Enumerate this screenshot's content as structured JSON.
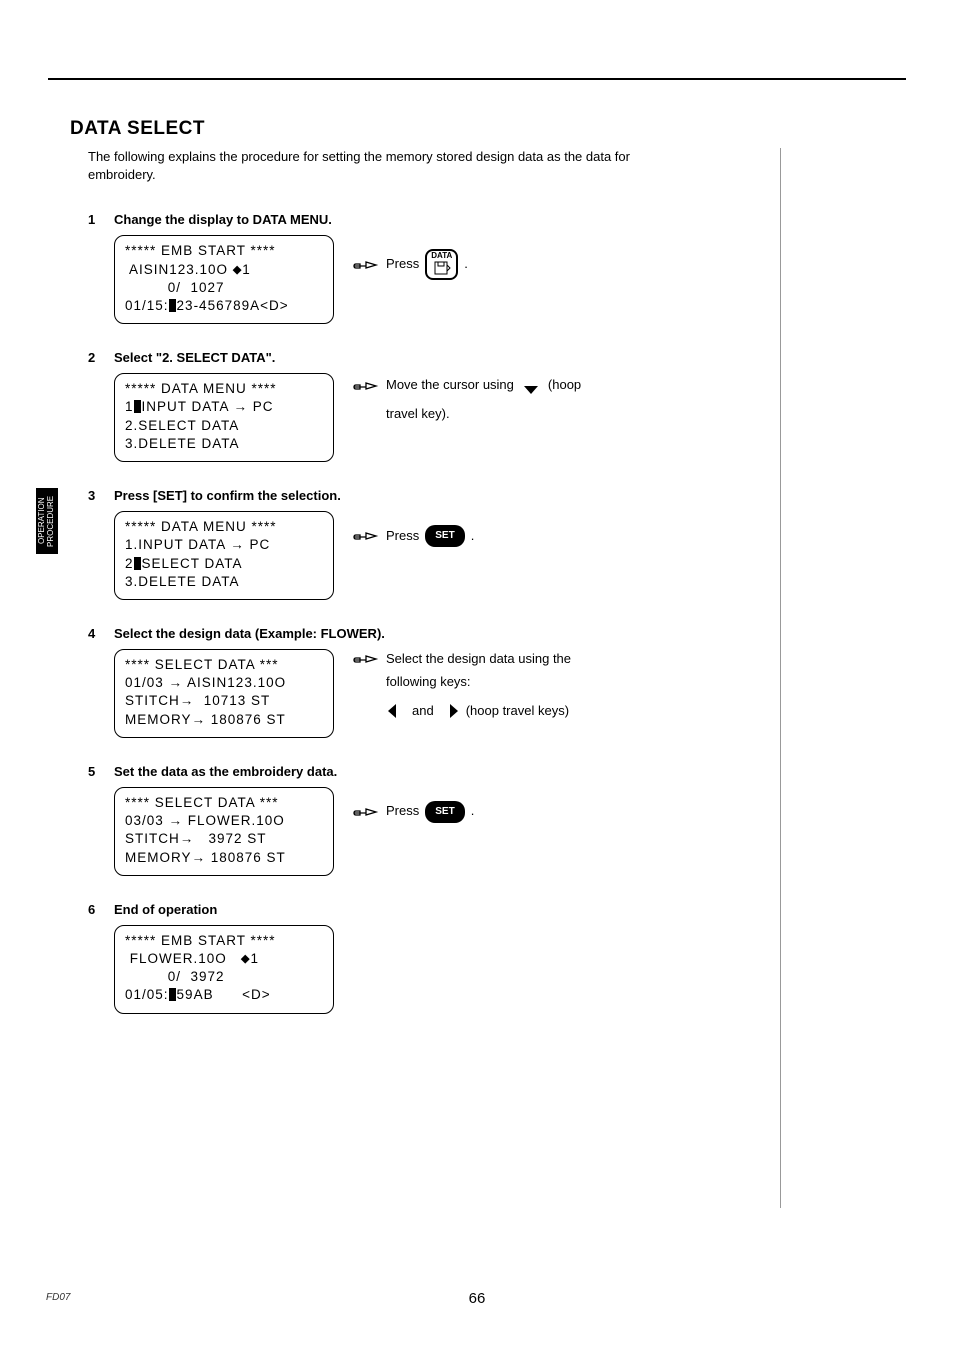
{
  "sideTab": "OPERATION\nPROCEDURE",
  "title": "DATA SELECT",
  "intro": "The following explains the procedure for setting the memory stored design data as the data for embroidery.",
  "dataKeyLabel": "DATA",
  "setKeyLabel": "SET",
  "steps": {
    "s1": {
      "num": "1",
      "title": "Change the display to DATA MENU.",
      "lcd": {
        "l1": "***** EMB START ****",
        "l2a": " AISIN123.10O ",
        "l2b": "1",
        "l3": "         0/  1027",
        "l4a": "01/15:",
        "l4b": "23-456789A<D>"
      },
      "instr": {
        "press": "Press",
        "dot": "."
      }
    },
    "s2": {
      "num": "2",
      "title": "Select \"2. SELECT DATA\".",
      "lcd": {
        "l1": "***** DATA MENU ****",
        "l2a": "1",
        "l2b": "INPUT DATA → PC",
        "l3": "2.SELECT DATA",
        "l4": "3.DELETE DATA"
      },
      "instr": {
        "t1": "Move the cursor using",
        "t2": "(hoop",
        "t3": "travel key)."
      }
    },
    "s3": {
      "num": "3",
      "title": "Press [SET] to confirm the selection.",
      "lcd": {
        "l1": "***** DATA MENU ****",
        "l2": "1.INPUT DATA → PC",
        "l3a": "2",
        "l3b": "SELECT DATA",
        "l4": "3.DELETE DATA"
      },
      "instr": {
        "press": "Press",
        "dot": "."
      }
    },
    "s4": {
      "num": "4",
      "title": "Select the design data (Example: FLOWER).",
      "lcd": {
        "l1": "**** SELECT DATA ***",
        "l2": "01/03 → AISIN123.10O",
        "l3": "STITCH→  10713 ST",
        "l4": "MEMORY→ 180876 ST"
      },
      "instr": {
        "t1": "Select the design data using the",
        "t2": "following keys:",
        "t3": "and",
        "t4": "(hoop travel keys)"
      }
    },
    "s5": {
      "num": "5",
      "title": "Set the data as the embroidery data.",
      "lcd": {
        "l1": "**** SELECT DATA ***",
        "l2": "03/03 → FLOWER.10O",
        "l3": "STITCH→   3972 ST",
        "l4": "MEMORY→ 180876 ST"
      },
      "instr": {
        "press": "Press",
        "dot": "."
      }
    },
    "s6": {
      "num": "6",
      "title": "End of operation",
      "lcd": {
        "l1": "***** EMB START ****",
        "l2a": " FLOWER.10O   ",
        "l2b": "1",
        "l3": "         0/  3972",
        "l4a": "01/05:",
        "l4b": "59AB      <D>"
      }
    }
  },
  "pageNumber": "66",
  "footerCode": "FD07"
}
